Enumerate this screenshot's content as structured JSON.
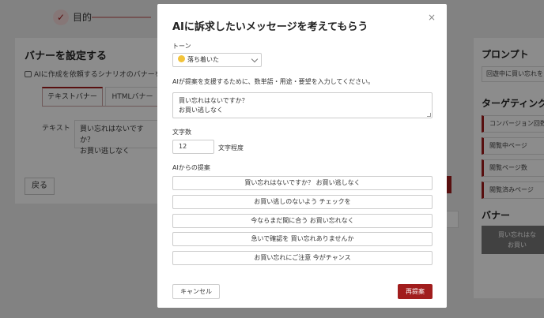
{
  "background": {
    "step_label": "目的",
    "left_panel": {
      "title": "バナーを設定する",
      "note": "AIに作成を依頼するシナリオのバナーを設",
      "tabs": [
        {
          "label": "テキストバナー"
        },
        {
          "label": "HTMLバナー"
        }
      ],
      "text_label": "テキスト",
      "text_line1": "買い忘れはないですか？",
      "text_line2": "お買い逃しなく",
      "back_label": "戻る"
    },
    "right_panel": {
      "prompt_title": "プロンプト",
      "prompt_value": "回遊中に買い忘れを",
      "targeting_title": "ターゲティング",
      "targeting_items": [
        "コンバージョン回数",
        "閲覧中ページ",
        "閲覧ページ数",
        "閲覧済みページ"
      ],
      "banner_title": "バナー",
      "banner_line1": "買い忘れはな",
      "banner_line2": "お買い"
    }
  },
  "modal": {
    "title": "AIに訴求したいメッセージを考えてもらう",
    "close_icon": "×",
    "tone_label": "トーン",
    "tone_value": "落ち着いた",
    "request_label": "AIが提案を支援するために、数単語・用途・要望を入力してください。",
    "request_line1": "買い忘れはないですか？",
    "request_line2": "お買い逃しなく",
    "count_label": "文字数",
    "count_value": "12",
    "count_unit": "文字程度",
    "suggestions_label": "AIからの提案",
    "suggestions": [
      "買い忘れはないですか？ お買い逃しなく",
      "お買い逃しのないよう チェックを",
      "今ならまだ間に合う お買い忘れなく",
      "急いで確認を 買い忘れありませんか",
      "お買い忘れにご注意 今がチャンス"
    ],
    "cancel_label": "キャンセル",
    "retry_label": "再提案"
  },
  "colors": {
    "accent": "#a11d1d",
    "overlay": "rgba(0,0,0,0.45)"
  }
}
